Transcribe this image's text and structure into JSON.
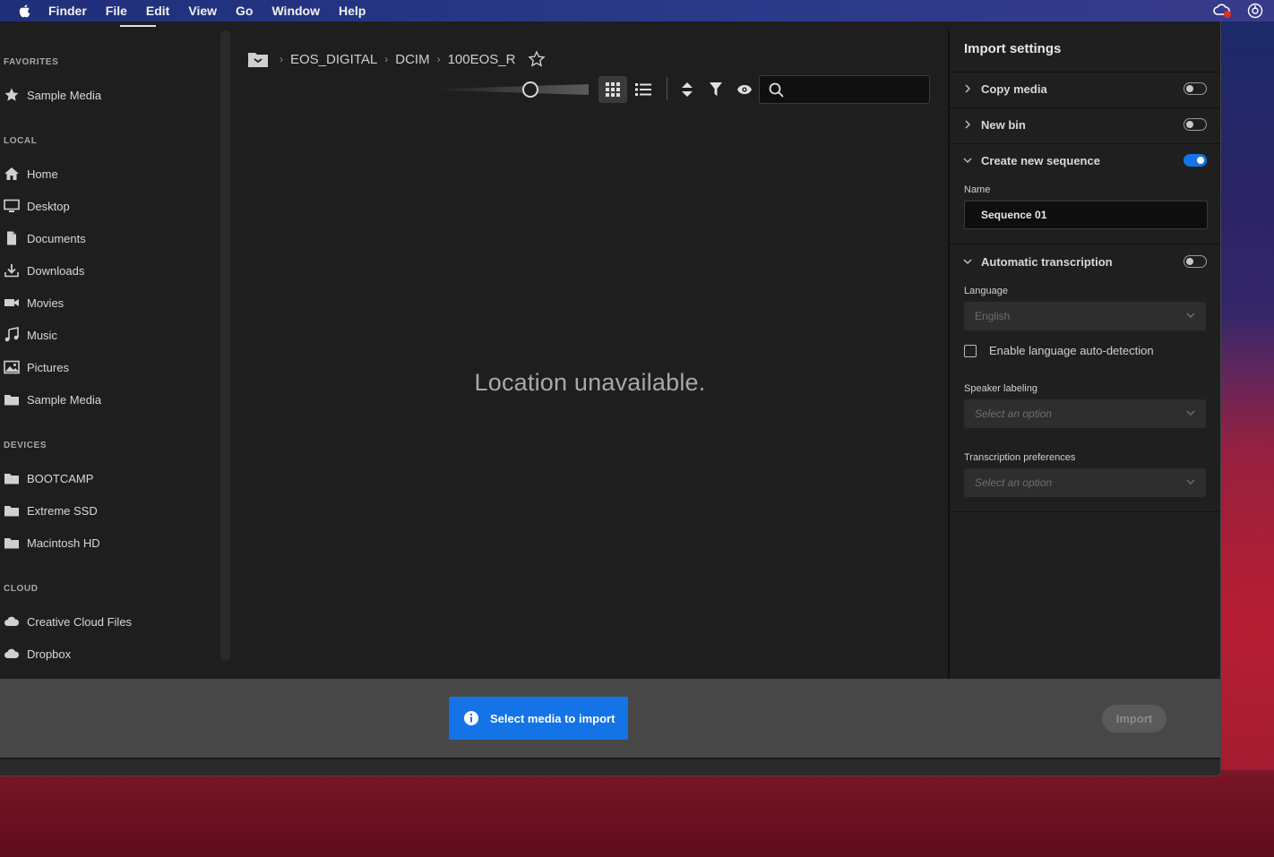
{
  "menubar": {
    "app": "Finder",
    "items": [
      "File",
      "Edit",
      "View",
      "Go",
      "Window",
      "Help"
    ]
  },
  "sidebar": {
    "sections": [
      {
        "title": "FAVORITES",
        "items": [
          {
            "label": "Sample Media",
            "icon": "star-icon"
          }
        ]
      },
      {
        "title": "LOCAL",
        "items": [
          {
            "label": "Home",
            "icon": "home-icon"
          },
          {
            "label": "Desktop",
            "icon": "desktop-icon"
          },
          {
            "label": "Documents",
            "icon": "document-icon"
          },
          {
            "label": "Downloads",
            "icon": "download-icon"
          },
          {
            "label": "Movies",
            "icon": "video-icon"
          },
          {
            "label": "Music",
            "icon": "music-icon"
          },
          {
            "label": "Pictures",
            "icon": "image-icon"
          },
          {
            "label": "Sample Media",
            "icon": "folder-icon"
          }
        ]
      },
      {
        "title": "DEVICES",
        "items": [
          {
            "label": "BOOTCAMP",
            "icon": "folder-icon"
          },
          {
            "label": "Extreme SSD",
            "icon": "folder-icon"
          },
          {
            "label": "Macintosh HD",
            "icon": "folder-icon"
          }
        ]
      },
      {
        "title": "CLOUD",
        "items": [
          {
            "label": "Creative Cloud Files",
            "icon": "cloud-icon"
          },
          {
            "label": "Dropbox",
            "icon": "cloud-icon"
          }
        ]
      }
    ]
  },
  "breadcrumb": [
    "EOS_DIGITAL",
    "DCIM",
    "100EOS_R"
  ],
  "toolbar": {
    "zoom_level": 0.62,
    "search_placeholder": ""
  },
  "main": {
    "empty_message": "Location unavailable."
  },
  "import_settings": {
    "title": "Import settings",
    "copy_media": {
      "label": "Copy media",
      "on": false,
      "expanded": false
    },
    "new_bin": {
      "label": "New bin",
      "on": false,
      "expanded": false
    },
    "create_sequence": {
      "label": "Create new sequence",
      "on": true,
      "expanded": true,
      "name_label": "Name",
      "name_value": "Sequence 01"
    },
    "auto_transcription": {
      "label": "Automatic transcription",
      "on": false,
      "expanded": true,
      "language_label": "Language",
      "language_value": "English",
      "auto_detect_label": "Enable language auto-detection",
      "auto_detect_checked": false,
      "speaker_label": "Speaker labeling",
      "speaker_placeholder": "Select an option",
      "prefs_label": "Transcription preferences",
      "prefs_placeholder": "Select an option"
    }
  },
  "bottombar": {
    "select_media_label": "Select media to import",
    "import_label": "Import"
  },
  "colors": {
    "accent": "#1473e6",
    "panel_bg": "#1e1e1e",
    "bottom_bar": "#474747"
  }
}
